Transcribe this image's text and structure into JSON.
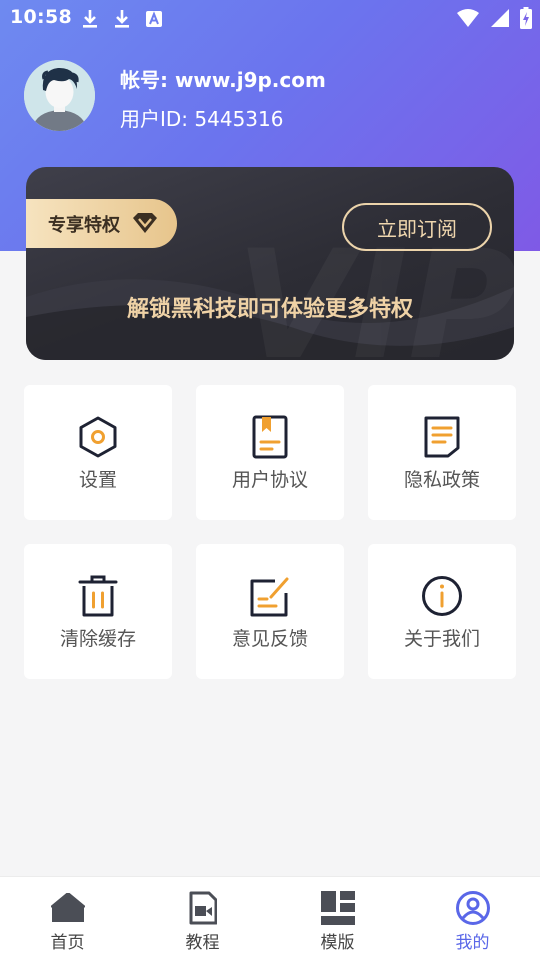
{
  "status_bar": {
    "time": "10:58",
    "left_icons": [
      "download-icon",
      "download-icon",
      "font-icon"
    ],
    "right_icons": [
      "wifi-icon",
      "signal-icon",
      "battery-charging-icon"
    ]
  },
  "profile": {
    "account": "帐号: www.j9p.com",
    "user_id": "用户ID: 5445316",
    "avatar_icon": "avatar"
  },
  "vip_card": {
    "badge_label": "专享特权",
    "badge_icon": "diamond-icon",
    "subscribe_label": "立即订阅",
    "slogan": "解锁黑科技即可体验更多特权"
  },
  "tiles": [
    {
      "label": "设置",
      "icon": "settings-hexagon-icon"
    },
    {
      "label": "用户协议",
      "icon": "agreement-book-icon"
    },
    {
      "label": "隐私政策",
      "icon": "privacy-document-icon"
    },
    {
      "label": "清除缓存",
      "icon": "trash-icon"
    },
    {
      "label": "意见反馈",
      "icon": "feedback-edit-icon"
    },
    {
      "label": "关于我们",
      "icon": "info-icon"
    }
  ],
  "bottom_nav": [
    {
      "label": "首页",
      "icon": "home-icon",
      "active": false
    },
    {
      "label": "教程",
      "icon": "tutorial-video-icon",
      "active": false
    },
    {
      "label": "模版",
      "icon": "template-grid-icon",
      "active": false
    },
    {
      "label": "我的",
      "icon": "profile-icon",
      "active": true
    }
  ],
  "colors": {
    "header_gradient_start": "#6e8af0",
    "header_gradient_end": "#7f5ae6",
    "accent_orange": "#f0a030",
    "active_nav": "#5a67e8",
    "vip_gold": "#efd2a6"
  }
}
